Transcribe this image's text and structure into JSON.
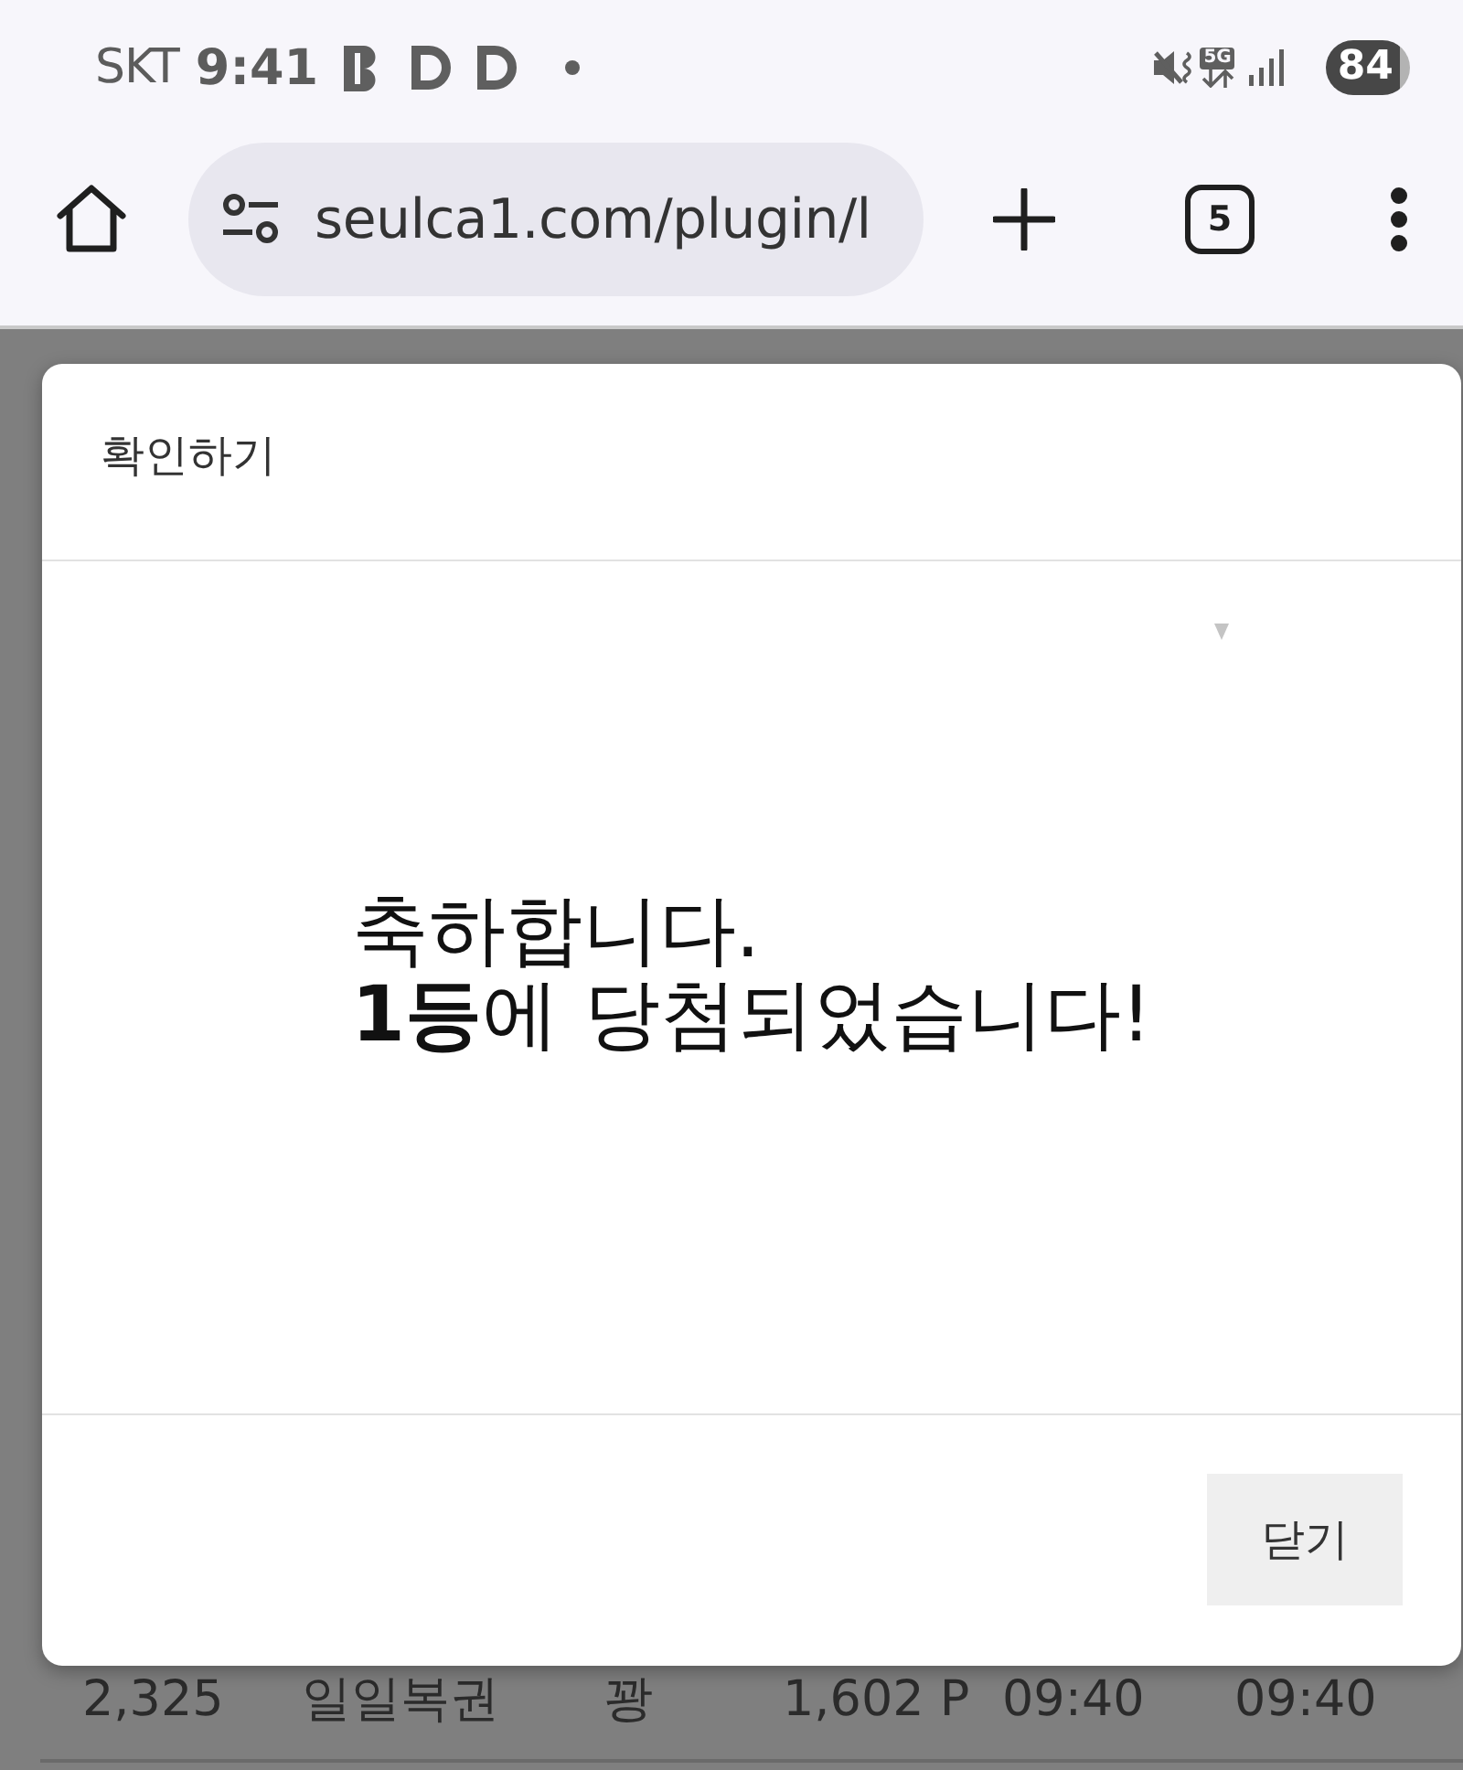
{
  "status_bar": {
    "carrier": "SKT",
    "time": "9:41",
    "network": "5G",
    "battery": "84"
  },
  "toolbar": {
    "url": "seulca1.com/plugin/l",
    "tab_count": "5"
  },
  "table": {
    "rows": [
      {
        "column_1": "2,325",
        "column_2": "일일복권",
        "column_3": "꽝",
        "column_4": "1,602 P",
        "column_5": "09:40",
        "column_6": "09:40"
      }
    ]
  },
  "dialog": {
    "title": "확인하기",
    "message": "축하합니다.\n**1등**에 당첨되었습니다!",
    "buttons": [
      "닫기"
    ]
  }
}
